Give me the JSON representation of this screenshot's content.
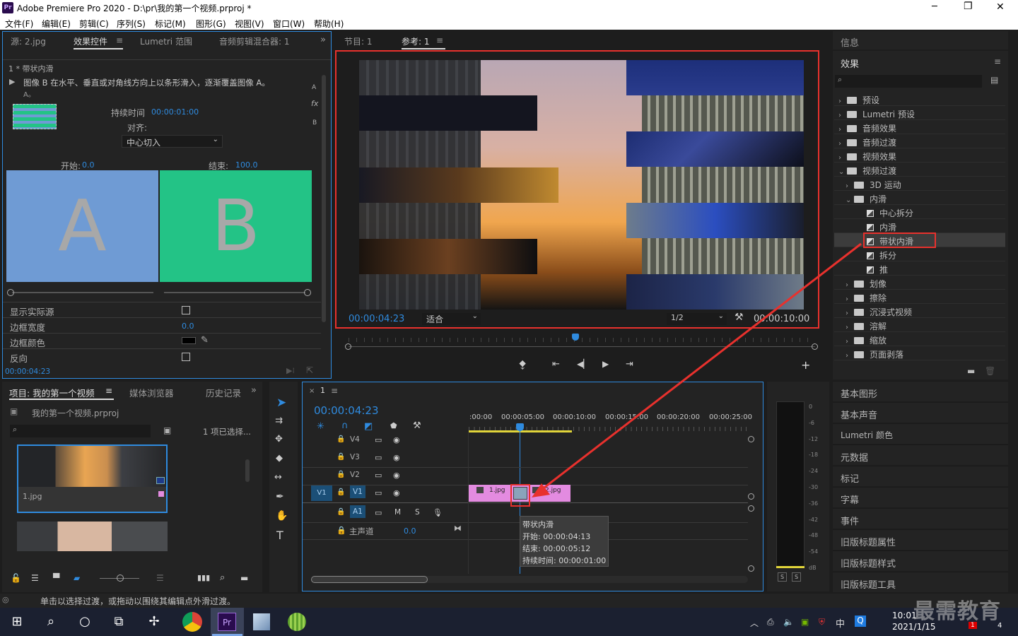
{
  "window": {
    "app_icon": "Pr",
    "title": "Adobe Premiere Pro 2020 - D:\\pr\\我的第一个视频.prproj *",
    "minimize": "─",
    "maximize": "❐",
    "close": "✕"
  },
  "menu": [
    "文件(F)",
    "编辑(E)",
    "剪辑(C)",
    "序列(S)",
    "标记(M)",
    "图形(G)",
    "视图(V)",
    "窗口(W)",
    "帮助(H)"
  ],
  "effect_controls": {
    "tabs": [
      "源: 2.jpg",
      "效果控件",
      "Lumetri 范围",
      "音频剪辑混合器: 1"
    ],
    "more": "»",
    "breadcrumb": "1 * 带状内滑",
    "description": "图像 B 在水平、垂直或对角线方向上以条形滑入，逐渐覆盖图像 A。",
    "desc_line2": "A。",
    "duration_label": "持续时间",
    "duration_value": "00:00:01:00",
    "align_label": "对齐:",
    "align_value": "中心切入",
    "start_label": "开始:",
    "start_value": "0.0",
    "end_label": "结束:",
    "end_value": "100.0",
    "letter_a": "A",
    "letter_b": "B",
    "side_a": "A",
    "side_b": "B",
    "fx": "fx",
    "props": [
      {
        "label": "显示实际源"
      },
      {
        "label": "边框宽度",
        "value": "0.0"
      },
      {
        "label": "边框颜色"
      },
      {
        "label": "反向"
      }
    ],
    "timecode": "00:00:04:23"
  },
  "program": {
    "tabs": [
      "节目: 1",
      "参考: 1"
    ],
    "timecode": "00:00:04:23",
    "fit": "适合",
    "resolution": "1/2",
    "duration": "00:00:10:00"
  },
  "info_panel": {
    "title": "信息"
  },
  "effects": {
    "title": "效果",
    "items": [
      {
        "label": "预设",
        "level": 0,
        "chev": "›"
      },
      {
        "label": "Lumetri 预设",
        "level": 0,
        "chev": "›"
      },
      {
        "label": "音频效果",
        "level": 0,
        "chev": "›"
      },
      {
        "label": "音频过渡",
        "level": 0,
        "chev": "›"
      },
      {
        "label": "视频效果",
        "level": 0,
        "chev": "›"
      },
      {
        "label": "视频过渡",
        "level": 0,
        "chev": "⌄"
      },
      {
        "label": "3D 运动",
        "level": 1,
        "chev": "›"
      },
      {
        "label": "内滑",
        "level": 1,
        "chev": "⌄"
      },
      {
        "label": "中心拆分",
        "level": 2
      },
      {
        "label": "内滑",
        "level": 2
      },
      {
        "label": "带状内滑",
        "level": 2,
        "selected": true
      },
      {
        "label": "拆分",
        "level": 2
      },
      {
        "label": "推",
        "level": 2
      },
      {
        "label": "划像",
        "level": 1,
        "chev": "›"
      },
      {
        "label": "擦除",
        "level": 1,
        "chev": "›"
      },
      {
        "label": "沉浸式视频",
        "level": 1,
        "chev": "›"
      },
      {
        "label": "溶解",
        "level": 1,
        "chev": "›"
      },
      {
        "label": "缩放",
        "level": 1,
        "chev": "›"
      },
      {
        "label": "页面剥落",
        "level": 1,
        "chev": "›"
      }
    ]
  },
  "right_panels": [
    "基本图形",
    "基本声音",
    "Lumetri 颜色",
    "元数据",
    "标记",
    "字幕",
    "事件",
    "旧版标题属性",
    "旧版标题样式",
    "旧版标题工具"
  ],
  "project": {
    "tabs": [
      "项目: 我的第一个视频",
      "媒体浏览器",
      "历史记录"
    ],
    "more": "»",
    "file": "我的第一个视频.prproj",
    "selected": "1 项已选择...",
    "clip1": "1.jpg"
  },
  "timeline": {
    "seq_name": "1",
    "timecode": "00:00:04:23",
    "ruler": [
      ":00:00",
      "00:00:05:00",
      "00:00:10:00",
      "00:00:15:00",
      "00:00:20:00",
      "00:00:25:00"
    ],
    "tracks": [
      "V4",
      "V3",
      "V2",
      "V1",
      "A1"
    ],
    "src_v1": "V1",
    "mix_label": "主声道",
    "mix_value": "0.0",
    "m": "M",
    "s": "S",
    "clip1": "1.jpg",
    "clip2": "2.jpg",
    "tooltip": [
      "带状内滑",
      "开始: 00:00:04:13",
      "结束: 00:00:05:12",
      "持续时间: 00:00:01:00"
    ]
  },
  "meter": {
    "ticks": [
      "0",
      "-6",
      "-12",
      "-18",
      "-24",
      "-30",
      "-36",
      "-42",
      "-48",
      "-54",
      "dB"
    ],
    "buttons": [
      "S",
      "S"
    ]
  },
  "status": "单击以选择过渡，或拖动以围绕其编辑点外滑过渡。",
  "taskbar": {
    "time": "10:01",
    "date": "2021/1/15",
    "ime": "中",
    "badge": "1",
    "notif": "4",
    "pr": "Pr"
  },
  "watermark": "最需教育",
  "colors": {
    "accent_blue": "#2f8bdf",
    "highlight_red": "#e8312d",
    "clip_pink": "#e38be0",
    "panel_a": "#6f9bd4",
    "panel_b": "#23c386",
    "work_yellow": "#e0d43a"
  }
}
